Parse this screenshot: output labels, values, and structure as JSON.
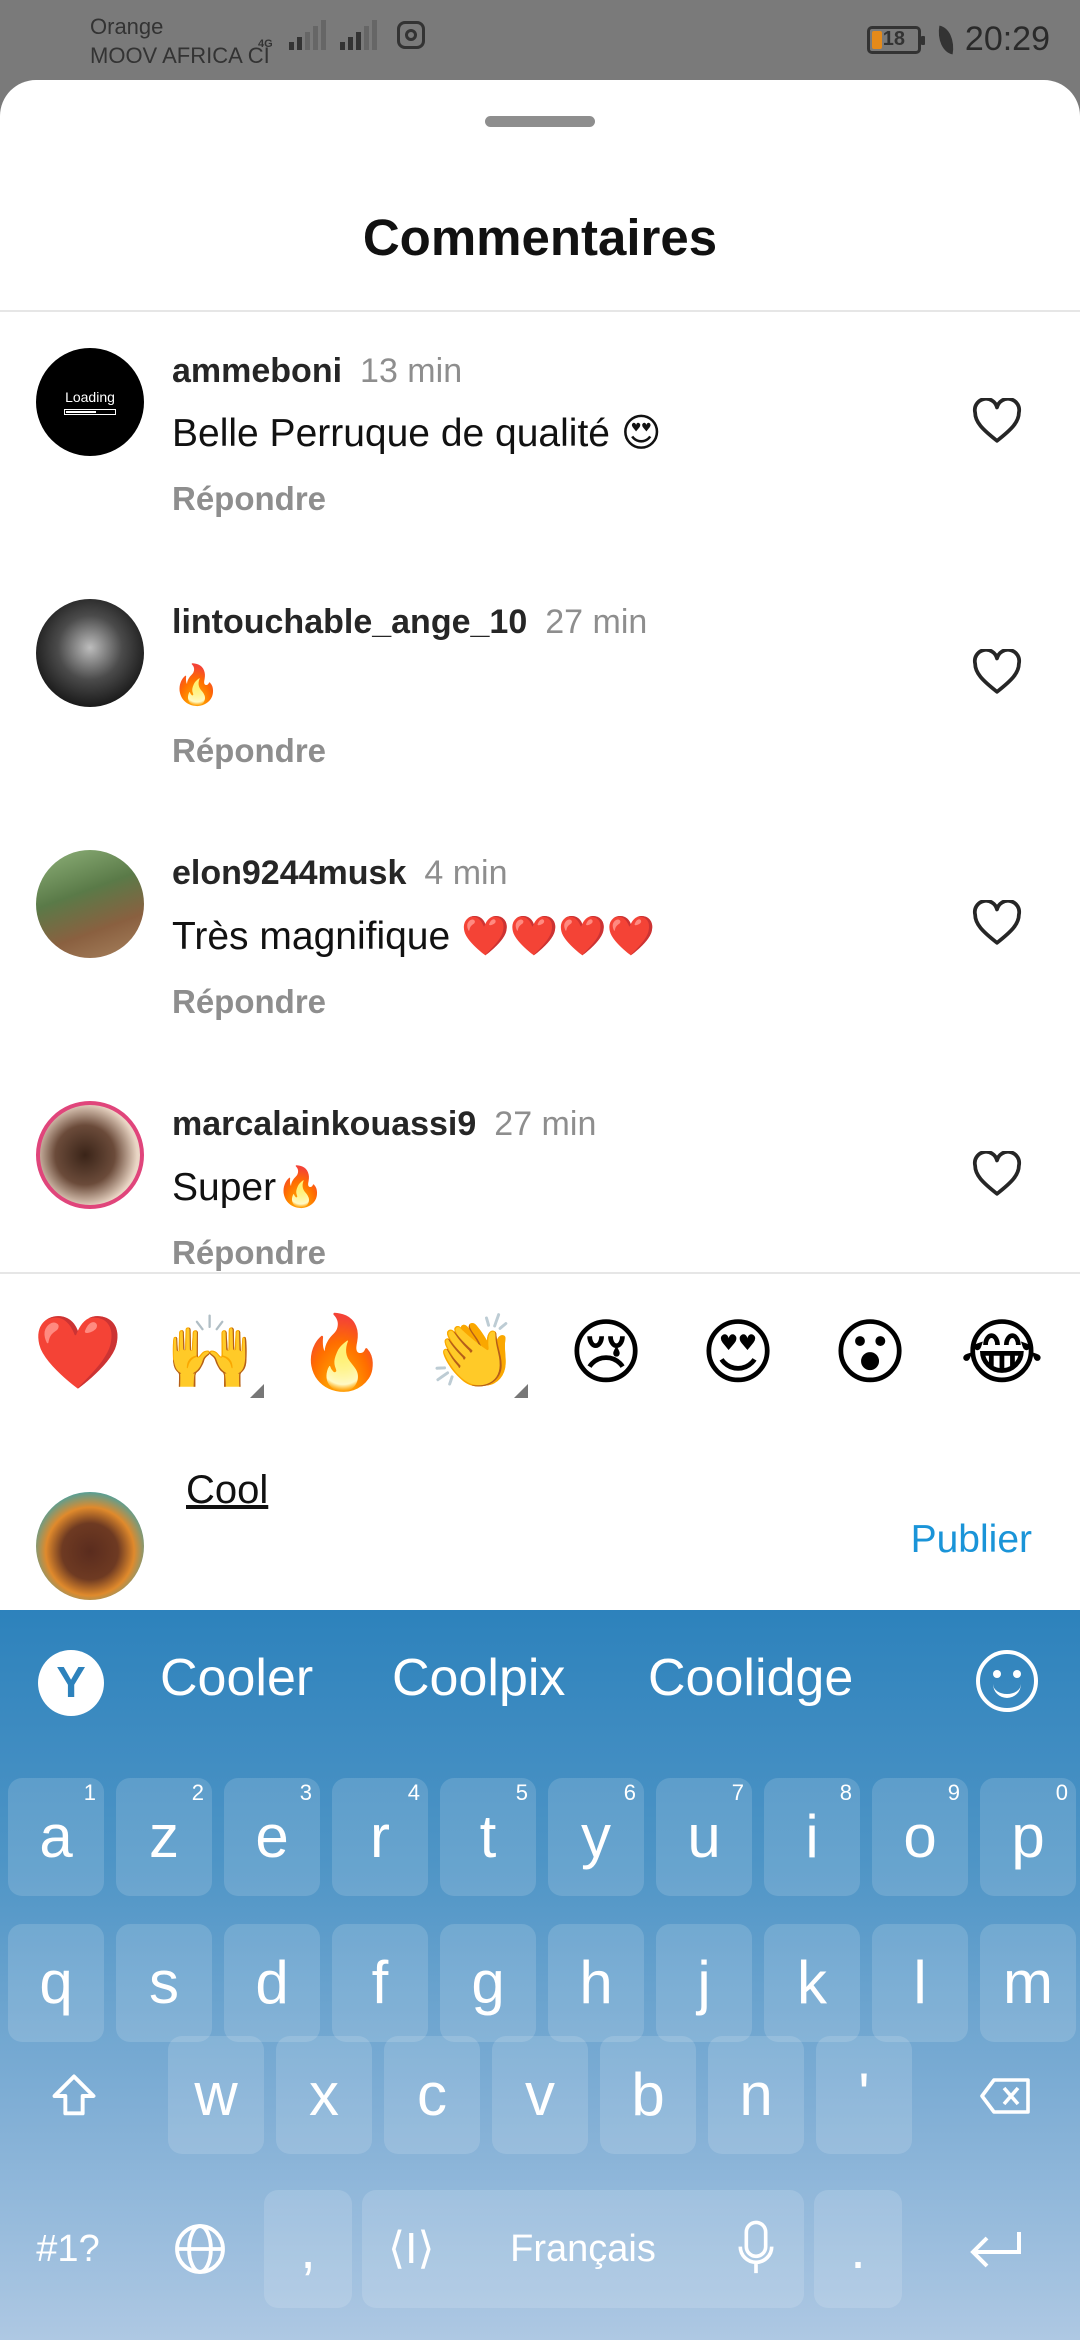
{
  "status_bar": {
    "carrier_line1": "Orange",
    "carrier_line2": "MOOV AFRICA CI",
    "network": "4G",
    "battery": "18",
    "time": "20:29"
  },
  "sheet": {
    "title": "Commentaires"
  },
  "comments": [
    {
      "user": "ammeboni",
      "time": "13 min",
      "text": "Belle Perruque de qualité 😍",
      "reply": "Répondre",
      "avatar_text": "Loading"
    },
    {
      "user": "lintouchable_ange_10",
      "time": "27 min",
      "text": "🔥",
      "reply": "Répondre"
    },
    {
      "user": "elon9244musk",
      "time": "4 min",
      "text": "Très magnifique ❤️❤️❤️❤️",
      "reply": "Répondre"
    },
    {
      "user": "marcalainkouassi9",
      "time": "27 min",
      "text": "Super🔥",
      "reply": "Répondre"
    }
  ],
  "emoji_bar": [
    "❤️",
    "🙌",
    "🔥",
    "👏",
    "😢",
    "😍",
    "😮",
    "😂"
  ],
  "compose": {
    "value": "Cool",
    "publish_label": "Publier"
  },
  "keyboard": {
    "suggestions": [
      "Cooler",
      "Coolpix",
      "Coolidge"
    ],
    "row1": [
      {
        "k": "a",
        "n": "1"
      },
      {
        "k": "z",
        "n": "2"
      },
      {
        "k": "e",
        "n": "3"
      },
      {
        "k": "r",
        "n": "4"
      },
      {
        "k": "t",
        "n": "5"
      },
      {
        "k": "y",
        "n": "6"
      },
      {
        "k": "u",
        "n": "7"
      },
      {
        "k": "i",
        "n": "8"
      },
      {
        "k": "o",
        "n": "9"
      },
      {
        "k": "p",
        "n": "0"
      }
    ],
    "row2": [
      "q",
      "s",
      "d",
      "f",
      "g",
      "h",
      "j",
      "k",
      "l",
      "m"
    ],
    "row3": [
      "w",
      "x",
      "c",
      "v",
      "b",
      "n",
      "'"
    ],
    "symbols_label": "#1?",
    "comma": ",",
    "space_label": "Français",
    "period": "."
  },
  "colors": {
    "accent": "#1a94d8",
    "keyboard_top": "#2d82bc",
    "keyboard_bottom": "#aec8e3"
  }
}
